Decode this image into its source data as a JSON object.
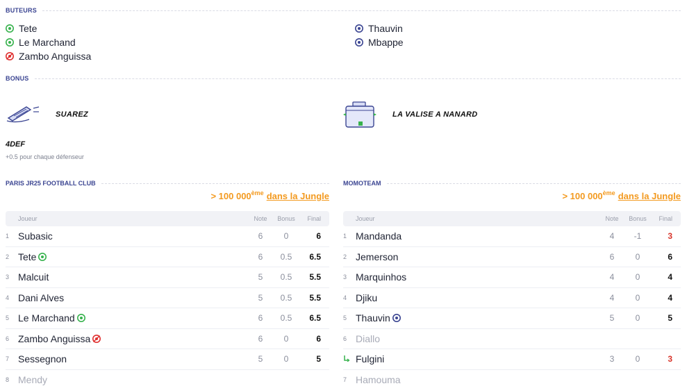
{
  "scorers": {
    "title": "BUTEURS",
    "left": [
      {
        "name": "Tete",
        "icon": "goal-icon",
        "color": "#37b24d"
      },
      {
        "name": "Le Marchand",
        "icon": "goal-icon",
        "color": "#37b24d"
      },
      {
        "name": "Zambo Anguissa",
        "icon": "own-goal-icon",
        "color": "#e03131"
      }
    ],
    "right": [
      {
        "name": "Thauvin",
        "icon": "goal-icon",
        "color": "#3b4592"
      },
      {
        "name": "Mbappe",
        "icon": "goal-icon",
        "color": "#3b4592"
      }
    ]
  },
  "bonus": {
    "title": "BONUS",
    "left_name": "SUAREZ",
    "right_name": "LA VALISE A NANARD",
    "formation": "4DEF",
    "formation_desc": "+0.5 pour chaque défenseur"
  },
  "teams": [
    {
      "name": "PARIS JR25 FOOTBALL CLUB",
      "rank_text": "> 100 000",
      "rank_sup": "ème",
      "rank_link": "dans la Jungle",
      "headers": {
        "player": "Joueur",
        "note": "Note",
        "bonus": "Bonus",
        "final": "Final"
      },
      "rows": [
        {
          "num": "1",
          "name": "Subasic",
          "note": "6",
          "bonus": "0",
          "final": "6"
        },
        {
          "num": "2",
          "name": "Tete",
          "note": "6",
          "bonus": "0.5",
          "final": "6.5"
        },
        {
          "num": "3",
          "name": "Malcuit",
          "note": "5",
          "bonus": "0.5",
          "final": "5.5"
        },
        {
          "num": "4",
          "name": "Dani Alves",
          "note": "5",
          "bonus": "0.5",
          "final": "5.5"
        },
        {
          "num": "5",
          "name": "Le Marchand",
          "note": "6",
          "bonus": "0.5",
          "final": "6.5"
        },
        {
          "num": "6",
          "name": "Zambo Anguissa",
          "note": "6",
          "bonus": "0",
          "final": "6"
        },
        {
          "num": "7",
          "name": "Sessegnon",
          "note": "5",
          "bonus": "0",
          "final": "5"
        },
        {
          "num": "8",
          "name": "Mendy",
          "note": "",
          "bonus": "",
          "final": ""
        }
      ]
    },
    {
      "name": "MOMOTEAM",
      "rank_text": "> 100 000",
      "rank_sup": "ème",
      "rank_link": "dans la Jungle",
      "headers": {
        "player": "Joueur",
        "note": "Note",
        "bonus": "Bonus",
        "final": "Final"
      },
      "rows": [
        {
          "num": "1",
          "name": "Mandanda",
          "note": "4",
          "bonus": "-1",
          "final": "3"
        },
        {
          "num": "2",
          "name": "Jemerson",
          "note": "6",
          "bonus": "0",
          "final": "6"
        },
        {
          "num": "3",
          "name": "Marquinhos",
          "note": "4",
          "bonus": "0",
          "final": "4"
        },
        {
          "num": "4",
          "name": "Djiku",
          "note": "4",
          "bonus": "0",
          "final": "4"
        },
        {
          "num": "5",
          "name": "Thauvin",
          "note": "5",
          "bonus": "0",
          "final": "5"
        },
        {
          "num": "6",
          "name": "Diallo",
          "note": "",
          "bonus": "",
          "final": ""
        },
        {
          "num": "",
          "name": "Fulgini",
          "note": "3",
          "bonus": "0",
          "final": "3"
        },
        {
          "num": "7",
          "name": "Hamouma",
          "note": "",
          "bonus": "",
          "final": ""
        }
      ]
    }
  ],
  "colors": {
    "accent": "#3b4592",
    "rank_orange": "#f39a20",
    "goal_green": "#37b24d",
    "own_goal_red": "#e03131",
    "negative_red": "#d8352b",
    "sub_green": "#37b24d"
  }
}
